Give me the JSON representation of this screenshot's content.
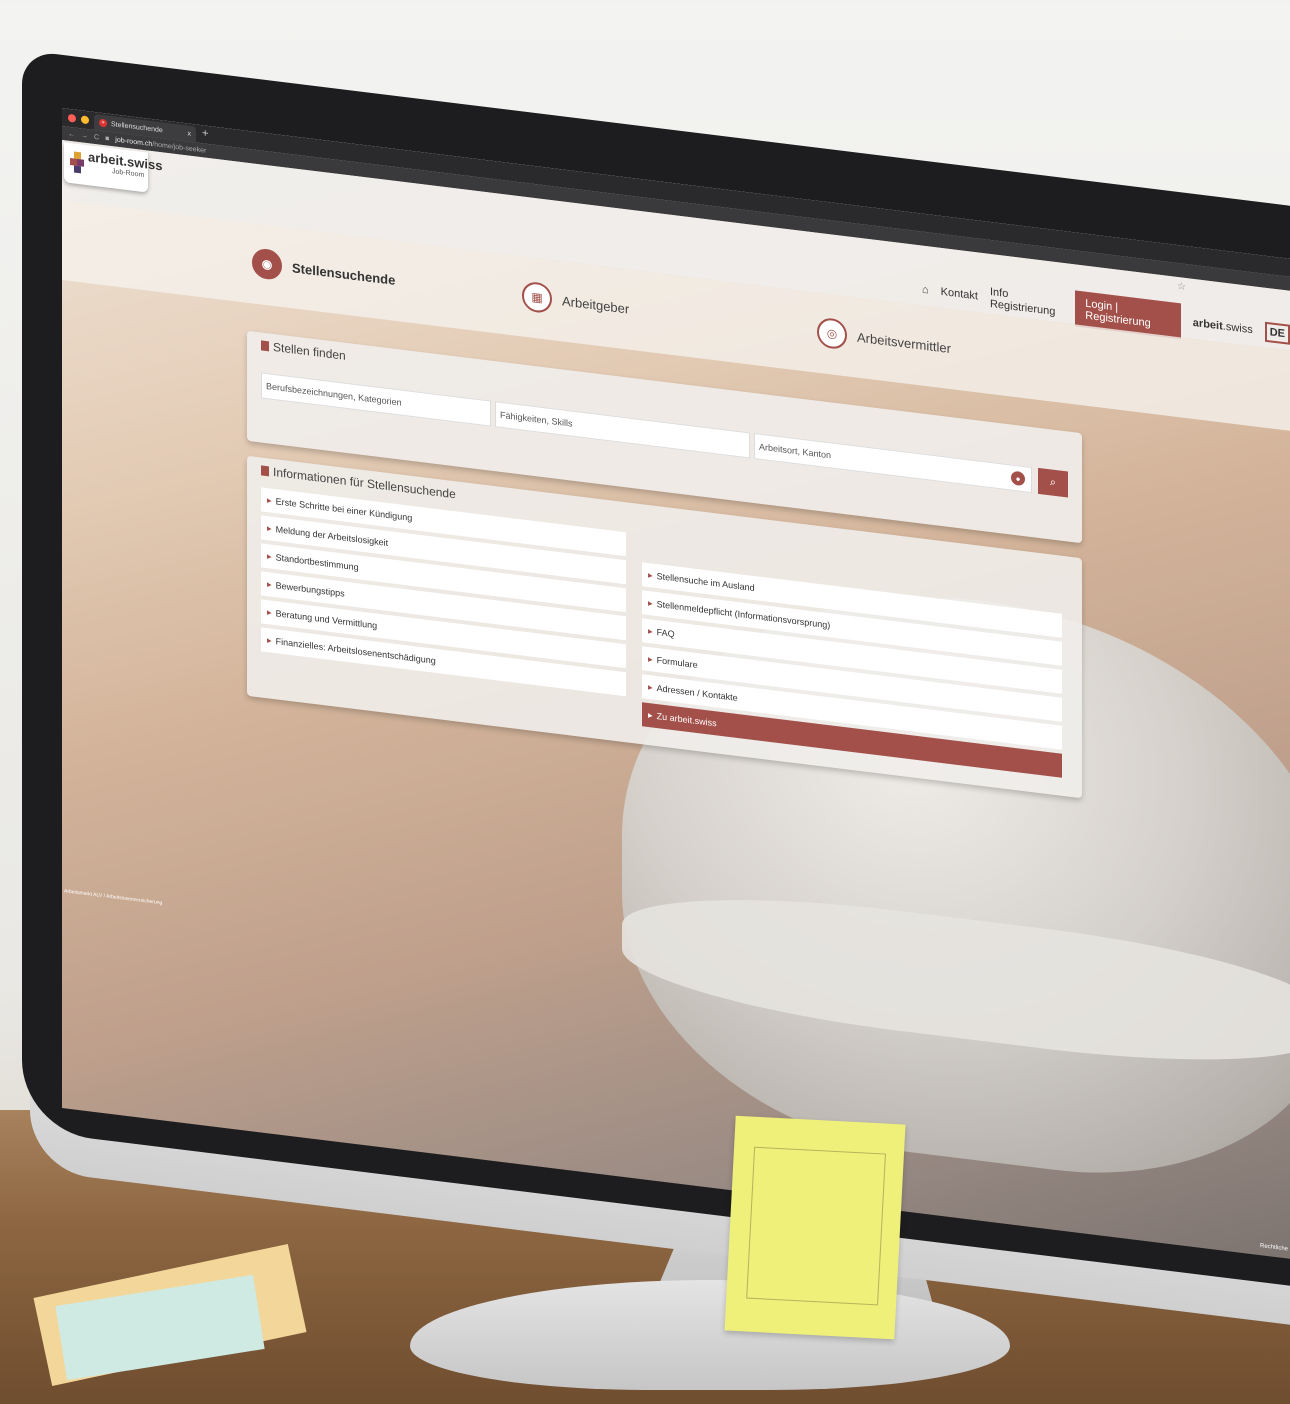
{
  "browser": {
    "tab_title": "Stellensuchende",
    "tab_close": "x",
    "new_tab": "+",
    "url_host": "job-room.ch",
    "url_path": "/home/job-seeker"
  },
  "header": {
    "logo_text": "arbeit.swiss",
    "logo_sub": "Job-Room",
    "nav": {
      "kontakt": "Kontakt",
      "info_registrierung": "Info Registrierung",
      "login": "Login | Registrierung",
      "brand_bold": "arbeit",
      "brand_rest": ".swiss",
      "lang": "DE"
    }
  },
  "roles": [
    {
      "label": "Stellensuchende",
      "active": true,
      "icon": "binoculars-icon"
    },
    {
      "label": "Arbeitgeber",
      "active": false,
      "icon": "building-icon"
    },
    {
      "label": "Arbeitsvermittler",
      "active": false,
      "icon": "eye-icon"
    }
  ],
  "search": {
    "title": "Stellen finden",
    "occupation_placeholder": "Berufsbezeichnungen, Kategorien",
    "skills_placeholder": "Fähigkeiten, Skills",
    "location_placeholder": "Arbeitsort, Kanton"
  },
  "info": {
    "title": "Informationen für Stellensuchende",
    "left": [
      "Erste Schritte bei einer Kündigung",
      "Meldung der Arbeitslosigkeit",
      "Standortbestimmung",
      "Bewerbungstipps",
      "Beratung und Vermittlung",
      "Finanzielles: Arbeitslosenentschädigung"
    ],
    "right": [
      "Stellensuche im Ausland",
      "Stellenmeldepflicht (Informationsvorsprung)",
      "FAQ",
      "Formulare",
      "Adressen / Kontakte",
      "Zu arbeit.swiss"
    ]
  },
  "footer": {
    "left": "Arbeitsmarkt ALV / Arbeitslosenversicherung",
    "right": "Rechtliche"
  },
  "colors": {
    "accent": "#a3504a"
  }
}
